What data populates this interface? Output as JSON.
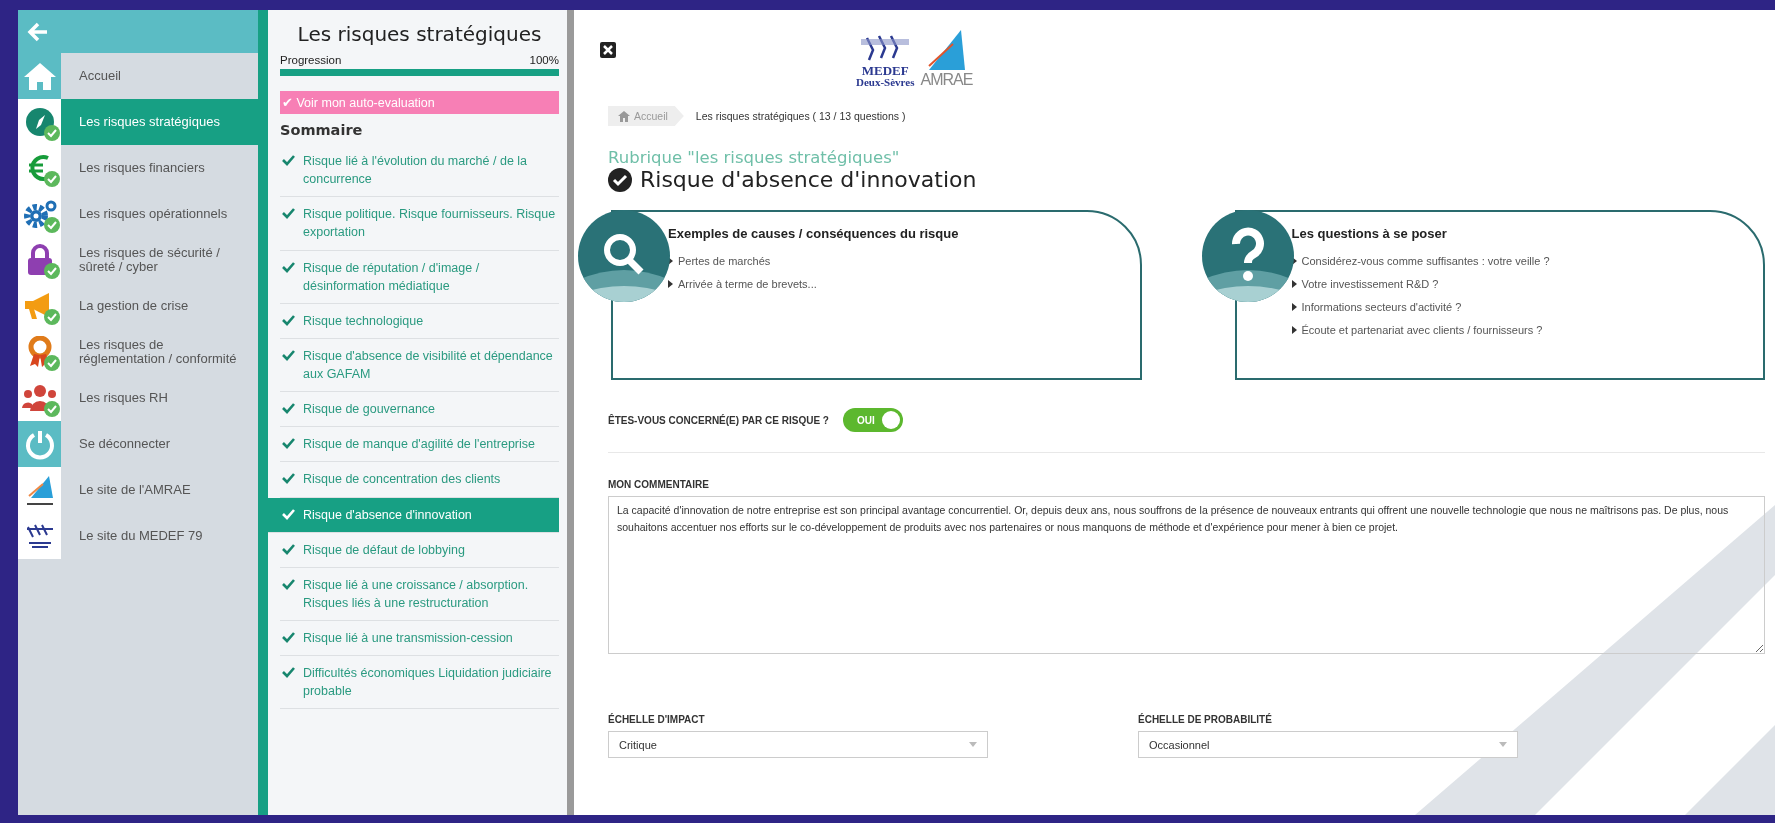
{
  "sidebar": {
    "items": [
      {
        "label": "Accueil",
        "kind": "home",
        "done": false,
        "selected": false
      },
      {
        "label": "Les risques stratégiques",
        "kind": "compass",
        "done": true,
        "selected": true
      },
      {
        "label": "Les risques financiers",
        "kind": "euro",
        "done": true,
        "selected": false
      },
      {
        "label": "Les risques opérationnels",
        "kind": "gears",
        "done": true,
        "selected": false
      },
      {
        "label": "Les risques de sécurité / sûreté / cyber",
        "kind": "lock",
        "done": true,
        "selected": false
      },
      {
        "label": "La gestion de crise",
        "kind": "megaphone",
        "done": true,
        "selected": false
      },
      {
        "label": "Les risques de réglementation / conformité",
        "kind": "medal",
        "done": true,
        "selected": false
      },
      {
        "label": "Les risques RH",
        "kind": "people",
        "done": true,
        "selected": false
      },
      {
        "label": "Se déconnecter",
        "kind": "power",
        "done": false,
        "selected": false
      },
      {
        "label": "Le site de l'AMRAE",
        "kind": "amrae",
        "done": false,
        "selected": false
      },
      {
        "label": "Le site du MEDEF 79",
        "kind": "medef",
        "done": false,
        "selected": false
      }
    ]
  },
  "summary_panel": {
    "title": "Les risques stratégiques",
    "progress": {
      "label": "Progression",
      "reading": "100%",
      "level": 1
    },
    "evaluation_button": "✔ Voir mon auto-evaluation",
    "heading": "Sommaire",
    "items": [
      {
        "label": "Risque lié à l'évolution du marché / de la concurrence",
        "done": true,
        "selected": false
      },
      {
        "label": "Risque politique. Risque fournisseurs. Risque exportation",
        "done": true,
        "selected": false
      },
      {
        "label": "Risque de réputation / d'image / désinformation médiatique",
        "done": true,
        "selected": false
      },
      {
        "label": "Risque technologique",
        "done": true,
        "selected": false
      },
      {
        "label": "Risque d'absence de visibilité et dépendance aux GAFAM",
        "done": true,
        "selected": false
      },
      {
        "label": "Risque de gouvernance",
        "done": true,
        "selected": false
      },
      {
        "label": "Risque de manque d'agilité de l'entreprise",
        "done": true,
        "selected": false
      },
      {
        "label": "Risque de concentration des clients",
        "done": true,
        "selected": false
      },
      {
        "label": "Risque d'absence d'innovation",
        "done": true,
        "selected": true
      },
      {
        "label": "Risque de défaut de lobbying",
        "done": true,
        "selected": false
      },
      {
        "label": "Risque lié à une croissance / absorption. Risques liés à une restructuration",
        "done": true,
        "selected": false
      },
      {
        "label": "Risque lié à une transmission-cession",
        "done": true,
        "selected": false
      },
      {
        "label": "Difficultés économiques Liquidation judiciaire probable",
        "done": true,
        "selected": false
      }
    ]
  },
  "main": {
    "logos": {
      "medef": [
        "MEDEF",
        "Deux-Sèvres"
      ],
      "amrae": "AMRAE"
    },
    "breadcrumb": [
      "Accueil",
      "Les risques stratégiques ( 13 / 13 questions )"
    ],
    "section": "Rubrique \"les risques stratégiques\"",
    "title": "Risque d'absence d'innovation",
    "answered": true,
    "cards": [
      {
        "kind": "search",
        "title": "Exemples de causes / conséquences du risque",
        "items": [
          "Pertes de marchés",
          "Arrivée à terme de brevets..."
        ]
      },
      {
        "kind": "question",
        "title": "Les questions à se poser",
        "items": [
          "Considérez-vous comme suffisantes : votre veille ?",
          "Votre investissement R&D ?",
          "Informations secteurs d'activité ?",
          "Écoute et partenariat avec clients / fournisseurs ?"
        ]
      }
    ],
    "concern": {
      "label": "ÊTES-VOUS CONCERNÉ(E) PAR CE RISQUE ?",
      "on": true,
      "toggle_text": "OUI"
    },
    "comment": {
      "label": "MON COMMENTAIRE",
      "value": "La capacité d'innovation de notre entreprise est son principal avantage concurrentiel. Or, depuis deux ans, nous souffrons de la présence de nouveaux entrants qui offrent une nouvelle technologie que nous ne maîtrisons pas. De plus, nous souhaitons accentuer nos efforts sur le co-développement de produits avec nos partenaires or nous manquons de méthode et d'expérience pour mener à bien ce projet."
    },
    "selects": [
      {
        "label": "ÉCHELLE D'IMPACT",
        "value": "Critique"
      },
      {
        "label": "ÉCHELLE DE PROBABILITÉ",
        "value": "Occasionnel"
      }
    ]
  }
}
